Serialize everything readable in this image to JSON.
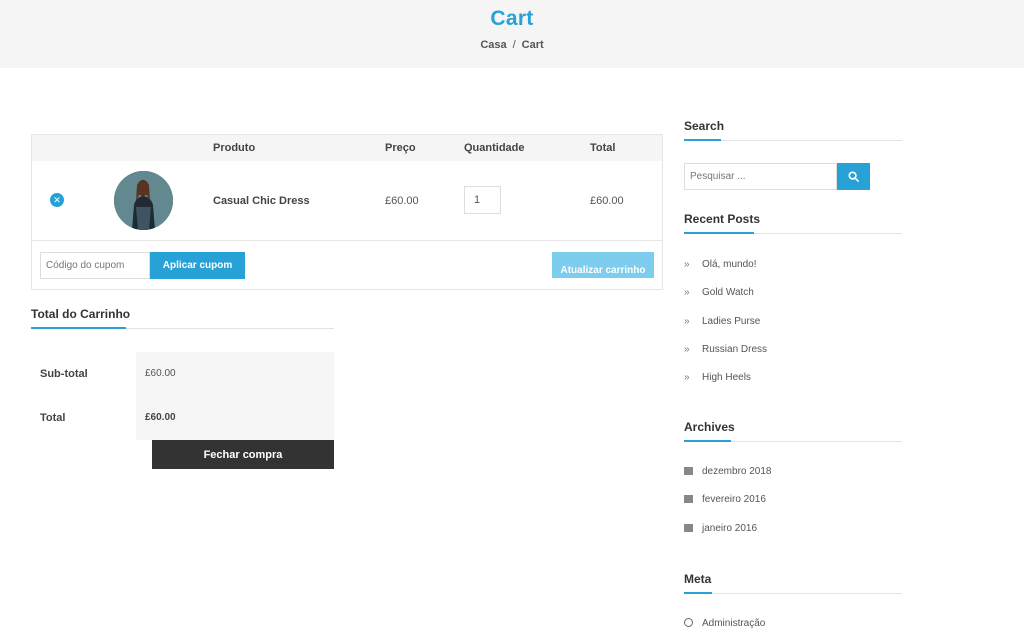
{
  "hero": {
    "title": "Cart",
    "breadcrumb": [
      "Casa",
      "/",
      "Cart"
    ]
  },
  "cart": {
    "headers": {
      "product": "Produto",
      "price": "Preço",
      "quantity": "Quantidade",
      "total": "Total"
    },
    "item": {
      "name": "Casual Chic Dress",
      "price": "£60.00",
      "quantity": "1",
      "total": "£60.00"
    },
    "coupon_placeholder": "Código do cupom",
    "apply_label": "Aplicar cupom",
    "update_label": "Atualizar carrinho"
  },
  "totals": {
    "title": "Total do Carrinho",
    "subtotal_label": "Sub-total",
    "subtotal_value": "£60.00",
    "total_label": "Total",
    "total_value": "£60.00",
    "checkout_label": "Fechar compra"
  },
  "sidebar": {
    "search": {
      "title": "Search",
      "placeholder": "Pesquisar ..."
    },
    "recent": {
      "title": "Recent Posts",
      "items": [
        "Olá, mundo!",
        "Gold Watch",
        "Ladies Purse",
        "Russian Dress",
        "High Heels"
      ]
    },
    "archives": {
      "title": "Archives",
      "items": [
        "dezembro 2018",
        "fevereiro 2016",
        "janeiro 2016"
      ]
    },
    "meta": {
      "title": "Meta",
      "items": [
        "Administração"
      ]
    }
  },
  "colors": {
    "accent": "#27a1d6",
    "dark": "#333333",
    "light_bg": "#f5f5f5"
  }
}
